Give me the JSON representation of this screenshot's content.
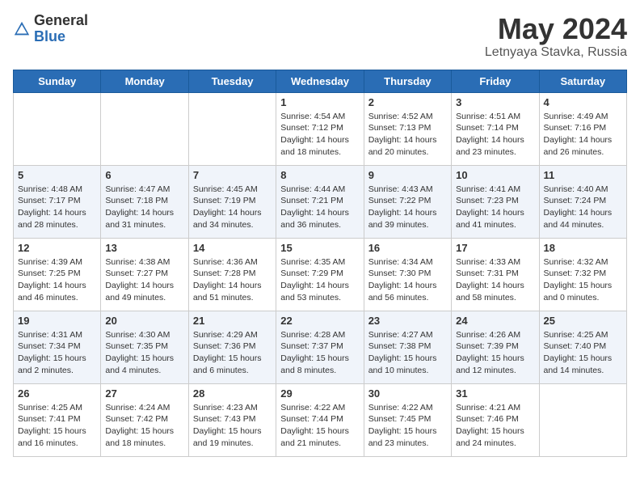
{
  "header": {
    "logo_general": "General",
    "logo_blue": "Blue",
    "month": "May 2024",
    "location": "Letnyaya Stavka, Russia"
  },
  "weekdays": [
    "Sunday",
    "Monday",
    "Tuesday",
    "Wednesday",
    "Thursday",
    "Friday",
    "Saturday"
  ],
  "weeks": [
    [
      {
        "day": "",
        "info": ""
      },
      {
        "day": "",
        "info": ""
      },
      {
        "day": "",
        "info": ""
      },
      {
        "day": "1",
        "info": "Sunrise: 4:54 AM\nSunset: 7:12 PM\nDaylight: 14 hours\nand 18 minutes."
      },
      {
        "day": "2",
        "info": "Sunrise: 4:52 AM\nSunset: 7:13 PM\nDaylight: 14 hours\nand 20 minutes."
      },
      {
        "day": "3",
        "info": "Sunrise: 4:51 AM\nSunset: 7:14 PM\nDaylight: 14 hours\nand 23 minutes."
      },
      {
        "day": "4",
        "info": "Sunrise: 4:49 AM\nSunset: 7:16 PM\nDaylight: 14 hours\nand 26 minutes."
      }
    ],
    [
      {
        "day": "5",
        "info": "Sunrise: 4:48 AM\nSunset: 7:17 PM\nDaylight: 14 hours\nand 28 minutes."
      },
      {
        "day": "6",
        "info": "Sunrise: 4:47 AM\nSunset: 7:18 PM\nDaylight: 14 hours\nand 31 minutes."
      },
      {
        "day": "7",
        "info": "Sunrise: 4:45 AM\nSunset: 7:19 PM\nDaylight: 14 hours\nand 34 minutes."
      },
      {
        "day": "8",
        "info": "Sunrise: 4:44 AM\nSunset: 7:21 PM\nDaylight: 14 hours\nand 36 minutes."
      },
      {
        "day": "9",
        "info": "Sunrise: 4:43 AM\nSunset: 7:22 PM\nDaylight: 14 hours\nand 39 minutes."
      },
      {
        "day": "10",
        "info": "Sunrise: 4:41 AM\nSunset: 7:23 PM\nDaylight: 14 hours\nand 41 minutes."
      },
      {
        "day": "11",
        "info": "Sunrise: 4:40 AM\nSunset: 7:24 PM\nDaylight: 14 hours\nand 44 minutes."
      }
    ],
    [
      {
        "day": "12",
        "info": "Sunrise: 4:39 AM\nSunset: 7:25 PM\nDaylight: 14 hours\nand 46 minutes."
      },
      {
        "day": "13",
        "info": "Sunrise: 4:38 AM\nSunset: 7:27 PM\nDaylight: 14 hours\nand 49 minutes."
      },
      {
        "day": "14",
        "info": "Sunrise: 4:36 AM\nSunset: 7:28 PM\nDaylight: 14 hours\nand 51 minutes."
      },
      {
        "day": "15",
        "info": "Sunrise: 4:35 AM\nSunset: 7:29 PM\nDaylight: 14 hours\nand 53 minutes."
      },
      {
        "day": "16",
        "info": "Sunrise: 4:34 AM\nSunset: 7:30 PM\nDaylight: 14 hours\nand 56 minutes."
      },
      {
        "day": "17",
        "info": "Sunrise: 4:33 AM\nSunset: 7:31 PM\nDaylight: 14 hours\nand 58 minutes."
      },
      {
        "day": "18",
        "info": "Sunrise: 4:32 AM\nSunset: 7:32 PM\nDaylight: 15 hours\nand 0 minutes."
      }
    ],
    [
      {
        "day": "19",
        "info": "Sunrise: 4:31 AM\nSunset: 7:34 PM\nDaylight: 15 hours\nand 2 minutes."
      },
      {
        "day": "20",
        "info": "Sunrise: 4:30 AM\nSunset: 7:35 PM\nDaylight: 15 hours\nand 4 minutes."
      },
      {
        "day": "21",
        "info": "Sunrise: 4:29 AM\nSunset: 7:36 PM\nDaylight: 15 hours\nand 6 minutes."
      },
      {
        "day": "22",
        "info": "Sunrise: 4:28 AM\nSunset: 7:37 PM\nDaylight: 15 hours\nand 8 minutes."
      },
      {
        "day": "23",
        "info": "Sunrise: 4:27 AM\nSunset: 7:38 PM\nDaylight: 15 hours\nand 10 minutes."
      },
      {
        "day": "24",
        "info": "Sunrise: 4:26 AM\nSunset: 7:39 PM\nDaylight: 15 hours\nand 12 minutes."
      },
      {
        "day": "25",
        "info": "Sunrise: 4:25 AM\nSunset: 7:40 PM\nDaylight: 15 hours\nand 14 minutes."
      }
    ],
    [
      {
        "day": "26",
        "info": "Sunrise: 4:25 AM\nSunset: 7:41 PM\nDaylight: 15 hours\nand 16 minutes."
      },
      {
        "day": "27",
        "info": "Sunrise: 4:24 AM\nSunset: 7:42 PM\nDaylight: 15 hours\nand 18 minutes."
      },
      {
        "day": "28",
        "info": "Sunrise: 4:23 AM\nSunset: 7:43 PM\nDaylight: 15 hours\nand 19 minutes."
      },
      {
        "day": "29",
        "info": "Sunrise: 4:22 AM\nSunset: 7:44 PM\nDaylight: 15 hours\nand 21 minutes."
      },
      {
        "day": "30",
        "info": "Sunrise: 4:22 AM\nSunset: 7:45 PM\nDaylight: 15 hours\nand 23 minutes."
      },
      {
        "day": "31",
        "info": "Sunrise: 4:21 AM\nSunset: 7:46 PM\nDaylight: 15 hours\nand 24 minutes."
      },
      {
        "day": "",
        "info": ""
      }
    ]
  ]
}
